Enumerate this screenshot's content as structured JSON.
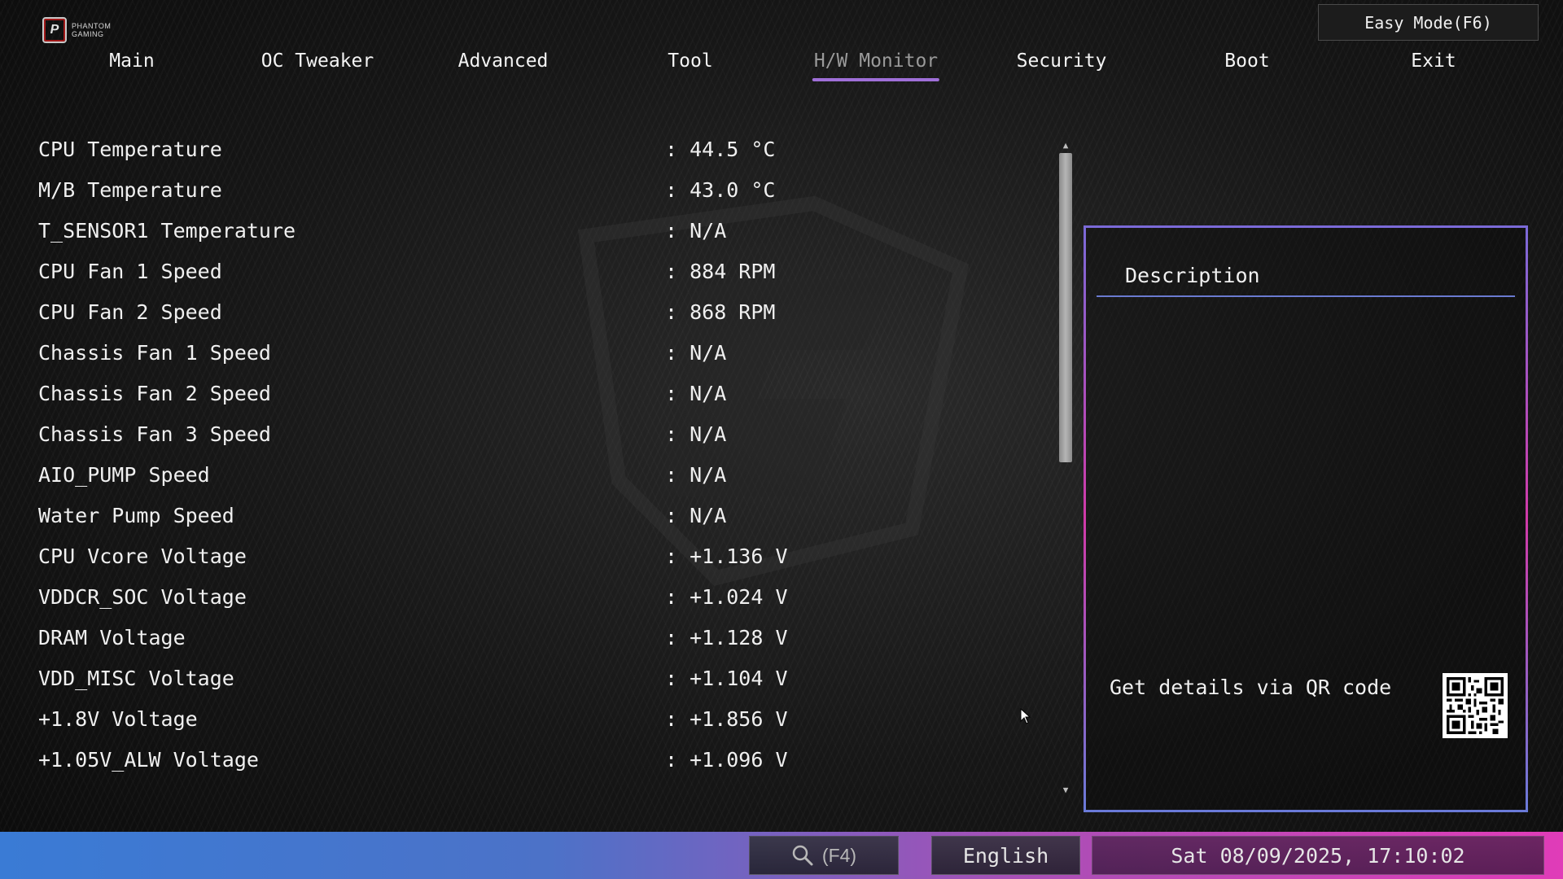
{
  "logo": {
    "line1": "PHANTOM",
    "line2": "GAMING"
  },
  "easy_mode_label": "Easy Mode(F6)",
  "tabs": [
    {
      "label": "Main"
    },
    {
      "label": "OC Tweaker"
    },
    {
      "label": "Advanced"
    },
    {
      "label": "Tool"
    },
    {
      "label": "H/W Monitor",
      "active": true
    },
    {
      "label": "Security"
    },
    {
      "label": "Boot"
    },
    {
      "label": "Exit"
    }
  ],
  "monitor_rows": [
    {
      "label": "CPU Temperature",
      "value": ": 44.5 °C"
    },
    {
      "label": "M/B Temperature",
      "value": ": 43.0 °C"
    },
    {
      "label": "T_SENSOR1 Temperature",
      "value": ": N/A"
    },
    {
      "label": "CPU Fan 1 Speed",
      "value": ": 884 RPM"
    },
    {
      "label": "CPU Fan 2 Speed",
      "value": ": 868 RPM"
    },
    {
      "label": "Chassis Fan 1 Speed",
      "value": ": N/A"
    },
    {
      "label": "Chassis Fan 2 Speed",
      "value": ": N/A"
    },
    {
      "label": "Chassis Fan 3 Speed",
      "value": ": N/A"
    },
    {
      "label": "AIO_PUMP Speed",
      "value": ": N/A"
    },
    {
      "label": "Water Pump Speed",
      "value": ": N/A"
    },
    {
      "label": "CPU Vcore Voltage",
      "value": ": +1.136 V"
    },
    {
      "label": "VDDCR_SOC Voltage",
      "value": ": +1.024 V"
    },
    {
      "label": "DRAM Voltage",
      "value": ": +1.128 V"
    },
    {
      "label": "VDD_MISC Voltage",
      "value": ": +1.104 V"
    },
    {
      "label": "+1.8V Voltage",
      "value": ": +1.856 V"
    },
    {
      "label": "+1.05V_ALW Voltage",
      "value": ": +1.096 V"
    }
  ],
  "description": {
    "title": "Description",
    "qr_text": "Get details via QR code"
  },
  "footer": {
    "search_label": "(F4)",
    "language": "English",
    "datetime": "Sat 08/09/2025, 17:10:02"
  },
  "colors": {
    "active_tab_underline": "#9f6fd8",
    "bottom_bar_start": "#3a7bd5",
    "bottom_bar_end": "#e03cb8"
  }
}
